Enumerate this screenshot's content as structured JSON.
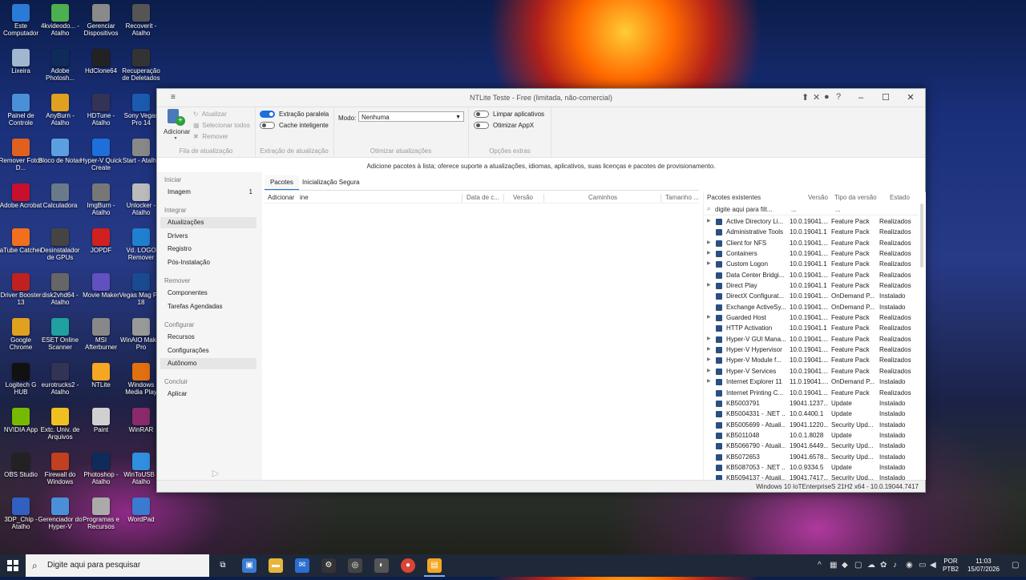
{
  "desktop_icons": [
    {
      "label": "Este Computador",
      "color": "#2a7bd6"
    },
    {
      "label": "4kvideodo... - Atalho",
      "color": "#4caf50"
    },
    {
      "label": "Gerenciar Dispositivos",
      "color": "#8a8a8a"
    },
    {
      "label": "Recoverit - Atalho",
      "color": "#555"
    },
    {
      "label": "Lixeira",
      "color": "#9fb8d0"
    },
    {
      "label": "Adobe Photosh...",
      "color": "#0f2b5a"
    },
    {
      "label": "HdClone64",
      "color": "#222"
    },
    {
      "label": "Recuperação de Deletados",
      "color": "#333"
    },
    {
      "label": "Painel de Controle",
      "color": "#4a90d9"
    },
    {
      "label": "AnyBurn - Atalho",
      "color": "#e0a020"
    },
    {
      "label": "HDTune - Atalho",
      "color": "#335"
    },
    {
      "label": "Sony Vegas Pro 14",
      "color": "#1a5bb0"
    },
    {
      "label": "Remover Fotos D...",
      "color": "#e06020"
    },
    {
      "label": "Bloco de Notas",
      "color": "#5aa0e0"
    },
    {
      "label": "Hyper-V Quick Create",
      "color": "#1e6fd9"
    },
    {
      "label": "Start - Atalho",
      "color": "#888"
    },
    {
      "label": "Adobe Acrobat",
      "color": "#c8102e"
    },
    {
      "label": "Calculadora",
      "color": "#6a7a8a"
    },
    {
      "label": "ImgBurn - Atalho",
      "color": "#777"
    },
    {
      "label": "Unlocker - Atalho",
      "color": "#bbb"
    },
    {
      "label": "aTube Catcher",
      "color": "#f07020"
    },
    {
      "label": "Desinstalador de GPUs",
      "color": "#444"
    },
    {
      "label": "JOPDF",
      "color": "#d02020"
    },
    {
      "label": "Vd. LOGO Remover",
      "color": "#2080d0"
    },
    {
      "label": "Driver Booster 13",
      "color": "#c02020"
    },
    {
      "label": "disk2vhd64 - Atalho",
      "color": "#666"
    },
    {
      "label": "Movie Maker",
      "color": "#6050c0"
    },
    {
      "label": "Vegas Mag Pro 18",
      "color": "#1a4a90"
    },
    {
      "label": "Google Chrome",
      "color": "#e0a020"
    },
    {
      "label": "ESET Online Scanner",
      "color": "#20a0a0"
    },
    {
      "label": "MSI Afterburner",
      "color": "#888"
    },
    {
      "label": "WinAIO Maker Pro",
      "color": "#999"
    },
    {
      "label": "Logitech G HUB",
      "color": "#111"
    },
    {
      "label": "eurotrucks2 - Atalho",
      "color": "#335"
    },
    {
      "label": "NTLite",
      "color": "#f5a623"
    },
    {
      "label": "Windows Media Play",
      "color": "#e07010"
    },
    {
      "label": "NVIDIA App",
      "color": "#76b900"
    },
    {
      "label": "Extc. Univ. de Arquivos",
      "color": "#f0c020"
    },
    {
      "label": "Paint",
      "color": "#d0d0d0"
    },
    {
      "label": "WinRAR",
      "color": "#8a2a6a"
    },
    {
      "label": "OBS Studio",
      "color": "#222"
    },
    {
      "label": "Firewall do Windows",
      "color": "#c04020"
    },
    {
      "label": "Photoshop - Atalho",
      "color": "#0f2b5a"
    },
    {
      "label": "WinToUSB - Atalho",
      "color": "#3090e0"
    },
    {
      "label": "3DP_Chip - Atalho",
      "color": "#3060c0"
    },
    {
      "label": "Gerenciador do Hyper-V",
      "color": "#4a90d9"
    },
    {
      "label": "Programas e Recursos",
      "color": "#aaa"
    },
    {
      "label": "WordPad",
      "color": "#3a7ad0"
    }
  ],
  "window": {
    "title": "NTLite Teste - Free (limitada, não-comercial)"
  },
  "ribbon": {
    "add_label": "Adicionar",
    "update_label": "Atualizar",
    "select_all_label": "Selecionar todos",
    "remove_label": "Remover",
    "group_update_queue": "Fila de atualização",
    "parallel_extract_label": "Extração paralela",
    "smart_cache_label": "Cache inteligente",
    "group_update_extract": "Extração de atualização",
    "mode_label": "Modo:",
    "mode_value": "Nenhuma",
    "group_optimize": "Otimizar atualizações",
    "clean_apps_label": "Limpar aplicativos",
    "optimize_appx_label": "Otimizar AppX",
    "group_extra": "Opções extras"
  },
  "info_text": "Adicione pacotes à lista; oferece suporte a atualizações, idiomas, aplicativos, suas licenças e pacotes de provisionamento.",
  "nav": {
    "start": "Iniciar",
    "image": "Imagem",
    "image_count": "1",
    "integrate": "Integrar",
    "updates": "Atualizações",
    "drivers": "Drivers",
    "registry": "Registro",
    "post_install": "Pós-Instalação",
    "remove": "Remover",
    "components": "Componentes",
    "scheduled_tasks": "Tarefas Agendadas",
    "configure": "Configurar",
    "resources": "Recursos",
    "settings": "Configurações",
    "unattended": "Autônomo",
    "finish": "Concluir",
    "apply": "Aplicar"
  },
  "tabs": {
    "packages": "Pacotes",
    "secure_boot": "Inicialização Segura"
  },
  "mid_columns": {
    "add": "Adicionar",
    "line": "ine",
    "date": "Data de c...",
    "version": "Versão",
    "paths": "Caminhos",
    "size": "Tamanho ..."
  },
  "existing": {
    "header_name": "Pacotes existentes",
    "header_version": "Versão",
    "header_type": "Tipo da versão",
    "header_state": "Estado",
    "search_placeholder": "digite aqui para filt...",
    "search_dots_1": "...",
    "search_dots_2": "...",
    "rows": [
      {
        "name": "Active Directory Li...",
        "version": "10.0.19041....",
        "type": "Feature Pack",
        "state": "Realizados",
        "exp": true
      },
      {
        "name": "Administrative Tools",
        "version": "10.0.19041.1",
        "type": "Feature Pack",
        "state": "Realizados",
        "exp": false
      },
      {
        "name": "Client for NFS",
        "version": "10.0.19041....",
        "type": "Feature Pack",
        "state": "Realizados",
        "exp": true
      },
      {
        "name": "Containers",
        "version": "10.0.19041....",
        "type": "Feature Pack",
        "state": "Realizados",
        "exp": true
      },
      {
        "name": "Custom Logon",
        "version": "10.0.19041.1",
        "type": "Feature Pack",
        "state": "Realizados",
        "exp": true
      },
      {
        "name": "Data Center Bridgi...",
        "version": "10.0.19041....",
        "type": "Feature Pack",
        "state": "Realizados",
        "exp": false
      },
      {
        "name": "Direct Play",
        "version": "10.0.19041.1",
        "type": "Feature Pack",
        "state": "Realizados",
        "exp": true
      },
      {
        "name": "DirectX Configurat...",
        "version": "10.0.19041....",
        "type": "OnDemand P...",
        "state": "Instalado",
        "exp": false
      },
      {
        "name": "Exchange ActiveSy...",
        "version": "10.0.19041....",
        "type": "OnDemand P...",
        "state": "Instalado",
        "exp": false
      },
      {
        "name": "Guarded Host",
        "version": "10.0.19041....",
        "type": "Feature Pack",
        "state": "Realizados",
        "exp": true
      },
      {
        "name": "HTTP Activation",
        "version": "10.0.19041.1",
        "type": "Feature Pack",
        "state": "Realizados",
        "exp": false
      },
      {
        "name": "Hyper-V GUI Mana...",
        "version": "10.0.19041....",
        "type": "Feature Pack",
        "state": "Realizados",
        "exp": true
      },
      {
        "name": "Hyper-V Hypervisor",
        "version": "10.0.19041....",
        "type": "Feature Pack",
        "state": "Realizados",
        "exp": true
      },
      {
        "name": "Hyper-V Module f...",
        "version": "10.0.19041....",
        "type": "Feature Pack",
        "state": "Realizados",
        "exp": true
      },
      {
        "name": "Hyper-V Services",
        "version": "10.0.19041....",
        "type": "Feature Pack",
        "state": "Realizados",
        "exp": true
      },
      {
        "name": "Internet Explorer 11",
        "version": "11.0.19041....",
        "type": "OnDemand P...",
        "state": "Instalado",
        "exp": true
      },
      {
        "name": "Internet Printing C...",
        "version": "10.0.19041....",
        "type": "Feature Pack",
        "state": "Realizados",
        "exp": false
      },
      {
        "name": "KB5003791",
        "version": "19041.1237....",
        "type": "Update",
        "state": "Instalado",
        "exp": false
      },
      {
        "name": "KB5004331 - .NET ...",
        "version": "10.0.4400.1",
        "type": "Update",
        "state": "Instalado",
        "exp": false
      },
      {
        "name": "KB5005699 - Atuali...",
        "version": "19041.1220....",
        "type": "Security Upd...",
        "state": "Instalado",
        "exp": false
      },
      {
        "name": "KB5011048",
        "version": "10.0.1.8028",
        "type": "Update",
        "state": "Instalado",
        "exp": false
      },
      {
        "name": "KB5066790 - Atuali...",
        "version": "19041.6449....",
        "type": "Security Upd...",
        "state": "Instalado",
        "exp": false
      },
      {
        "name": "KB5072653",
        "version": "19041.6578....",
        "type": "Security Upd...",
        "state": "Instalado",
        "exp": false
      },
      {
        "name": "KB5087053 - .NET ...",
        "version": "10.0.9334.5",
        "type": "Update",
        "state": "Instalado",
        "exp": false
      },
      {
        "name": "KB5094137 - Atuali...",
        "version": "19041.7417....",
        "type": "Security Upd...",
        "state": "Instalado",
        "exp": false
      }
    ]
  },
  "status_text": "Windows 10 IoTEnterpriseS 21H2 x64 - 10.0.19044.7417",
  "taskbar": {
    "search_placeholder": "Digite aqui para pesquisar",
    "lang_top": "POR",
    "lang_bottom": "PTB2",
    "time": "11:03",
    "date": "15/07/2026"
  },
  "colors": {
    "accent": "#1e6fd9",
    "taskbar": "#1f2838"
  }
}
